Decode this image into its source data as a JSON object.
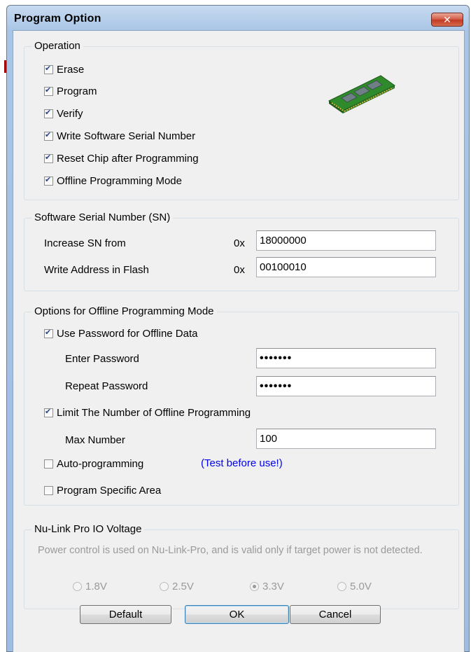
{
  "window": {
    "title": "Program Option",
    "close_label": "✕"
  },
  "operation": {
    "title": "Operation",
    "items": [
      {
        "label": "Erase",
        "checked": true
      },
      {
        "label": "Program",
        "checked": true
      },
      {
        "label": "Verify",
        "checked": true
      },
      {
        "label": "Write Software Serial Number",
        "checked": true
      },
      {
        "label": "Reset Chip after Programming",
        "checked": true
      },
      {
        "label": "Offline Programming Mode",
        "checked": true
      }
    ]
  },
  "serial": {
    "title": "Software Serial Number (SN)",
    "increase_label": "Increase SN from",
    "increase_prefix": "0x",
    "increase_value": "18000000",
    "address_label": "Write Address in Flash",
    "address_prefix": "0x",
    "address_value": "00100010"
  },
  "offline": {
    "title": "Options for Offline Programming Mode",
    "use_password_label": "Use Password for Offline Data",
    "use_password_checked": true,
    "enter_password_label": "Enter Password",
    "enter_password_value": "•••••••",
    "repeat_password_label": "Repeat Password",
    "repeat_password_value": "•••••••",
    "limit_label": "Limit The Number of Offline Programming",
    "limit_checked": true,
    "max_label": "Max Number",
    "max_value": "100",
    "auto_label": "Auto-programming",
    "auto_checked": false,
    "auto_note": "(Test before use!)",
    "specific_label": "Program Specific Area",
    "specific_checked": false
  },
  "voltage": {
    "title": "Nu-Link Pro IO Voltage",
    "description": "Power control is used on Nu-Link-Pro, and is valid only if target power is not detected.",
    "options": [
      {
        "label": "1.8V",
        "selected": false
      },
      {
        "label": "2.5V",
        "selected": false
      },
      {
        "label": "3.3V",
        "selected": true
      },
      {
        "label": "5.0V",
        "selected": false
      }
    ]
  },
  "buttons": {
    "default_label": "Default",
    "ok_label": "OK",
    "cancel_label": "Cancel"
  },
  "icons": {
    "chip_icon": "chip-icon",
    "close_icon": "close-icon"
  },
  "colors": {
    "title_bar": "#a9c5e6",
    "dialog_bg": "#f0f0f0",
    "link_note": "#0000ee"
  }
}
